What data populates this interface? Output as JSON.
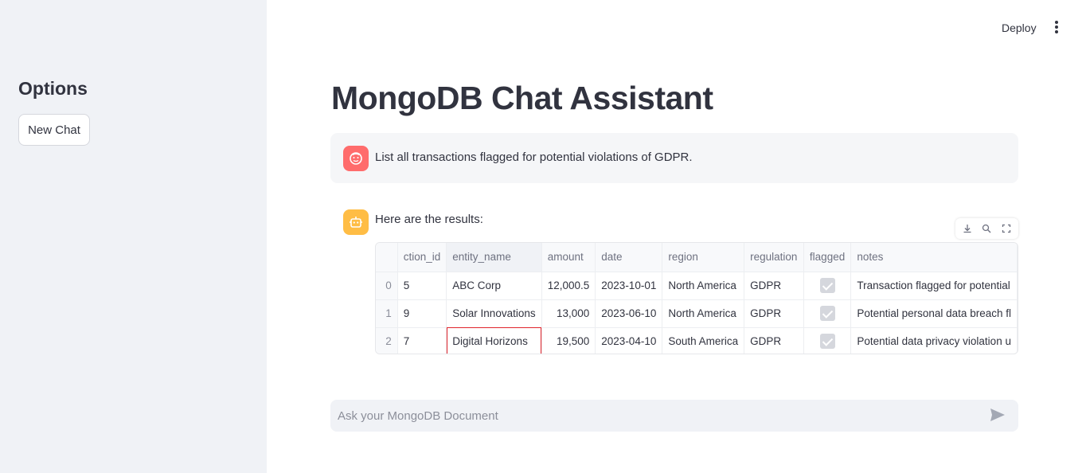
{
  "sidebar": {
    "title": "Options",
    "new_chat_label": "New Chat"
  },
  "header": {
    "deploy_label": "Deploy",
    "menu_icon": "kebab-menu-icon"
  },
  "main": {
    "title": "MongoDB Chat Assistant"
  },
  "messages": {
    "user": {
      "avatar_icon": "user-face-icon",
      "text": "List all transactions flagged for potential violations of GDPR."
    },
    "assistant": {
      "avatar_icon": "robot-icon",
      "text": "Here are the results:"
    }
  },
  "toolbar": {
    "icons": [
      "download-icon",
      "search-icon",
      "fullscreen-icon"
    ]
  },
  "table": {
    "columns": [
      "ction_id",
      "entity_name",
      "amount",
      "date",
      "region",
      "regulation",
      "flagged",
      "notes"
    ],
    "rows": [
      {
        "index": "0",
        "transaction_id": "5",
        "entity_name": "ABC Corp",
        "amount": "12,000.5",
        "date": "2023-10-01",
        "region": "North America",
        "regulation": "GDPR",
        "flagged": true,
        "notes": "Transaction flagged for potential"
      },
      {
        "index": "1",
        "transaction_id": "9",
        "entity_name": "Solar Innovations",
        "amount": "13,000",
        "date": "2023-06-10",
        "region": "North America",
        "regulation": "GDPR",
        "flagged": true,
        "notes": "Potential personal data breach fl"
      },
      {
        "index": "2",
        "transaction_id": "7",
        "entity_name": "Digital Horizons",
        "amount": "19,500",
        "date": "2023-04-10",
        "region": "South America",
        "regulation": "GDPR",
        "flagged": true,
        "notes": "Potential data privacy violation u"
      }
    ]
  },
  "chat_input": {
    "placeholder": "Ask your MongoDB Document",
    "send_icon": "send-icon"
  },
  "colors": {
    "sidebar_bg": "#f0f2f6",
    "user_avatar": "#ff6c6c",
    "bot_avatar": "#ffbd45",
    "selected_cell": "#e0242c"
  }
}
